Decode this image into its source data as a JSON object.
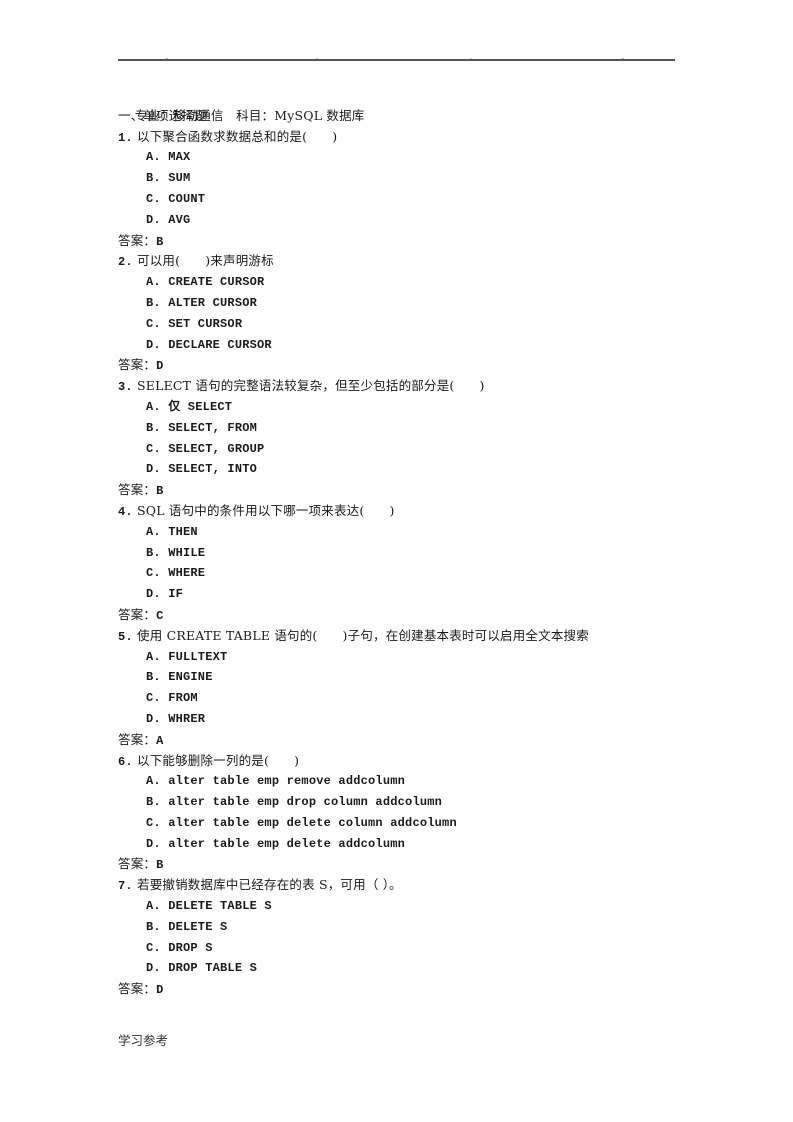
{
  "header": {
    "dots": [
      "..",
      ".",
      ".",
      ".."
    ]
  },
  "meta": {
    "major_label": "专业：",
    "major": "移动通信",
    "subject_label": "科目：",
    "subject": "MySQL 数据库"
  },
  "section_title": "一、单项选择题",
  "answer_label": "答案：",
  "questions": [
    {
      "number": "1.",
      "text": "以下聚合函数求数据总和的是(      )",
      "options": [
        "A. MAX",
        "B. SUM",
        "C. COUNT",
        "D. AVG"
      ],
      "answer": "B"
    },
    {
      "number": "2.",
      "text": "可以用(      )来声明游标",
      "options": [
        "A. CREATE CURSOR",
        "B. ALTER CURSOR",
        "C. SET CURSOR",
        "D. DECLARE CURSOR"
      ],
      "answer": "D"
    },
    {
      "number": "3.",
      "text": "SELECT 语句的完整语法较复杂，但至少包括的部分是(      )",
      "options": [
        "A. 仅 SELECT",
        "B. SELECT, FROM",
        "C. SELECT, GROUP",
        "D. SELECT, INTO"
      ],
      "answer": "B"
    },
    {
      "number": "4.",
      "text": "SQL 语句中的条件用以下哪一项来表达(      )",
      "options": [
        "A. THEN",
        "B. WHILE",
        "C. WHERE",
        "D. IF"
      ],
      "answer": "C"
    },
    {
      "number": "5.",
      "text": "使用 CREATE TABLE 语句的(      )子句，在创建基本表时可以启用全文本搜索",
      "options": [
        "A. FULLTEXT",
        "B. ENGINE",
        "C. FROM",
        "D. WHRER"
      ],
      "answer": "A"
    },
    {
      "number": "6.",
      "text": "以下能够删除一列的是(      )",
      "options": [
        "A. alter table emp remove addcolumn",
        "B. alter table emp drop column addcolumn",
        "C. alter table emp delete column addcolumn",
        "D. alter table emp delete addcolumn"
      ],
      "answer": "B"
    },
    {
      "number": "7.",
      "text": "若要撤销数据库中已经存在的表 S，可用（ ）。",
      "options": [
        "A. DELETE TABLE S",
        "B. DELETE S",
        "C. DROP S",
        "D. DROP TABLE S"
      ],
      "answer": "D"
    }
  ],
  "footer": "学习参考"
}
